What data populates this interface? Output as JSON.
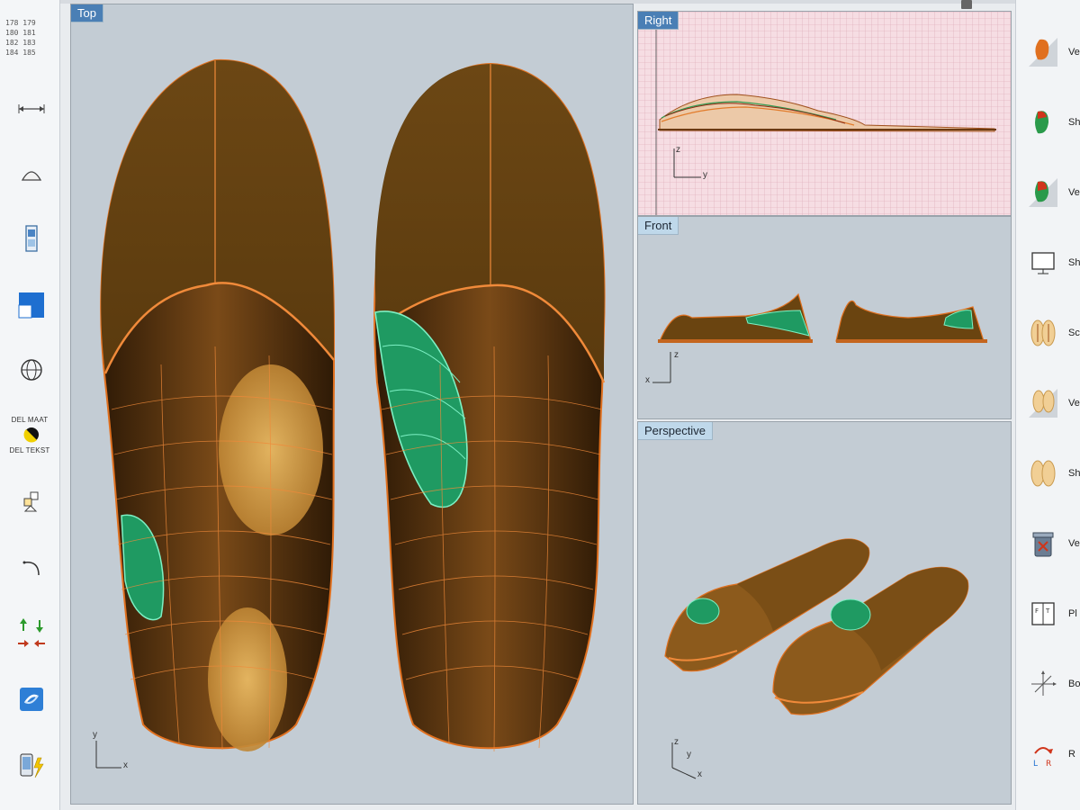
{
  "left_toolbar": {
    "numbers": [
      "178  179",
      "180  181",
      "182  183",
      "184  185"
    ],
    "del_maat": "DEL MAAT",
    "del_tekst": "DEL TEKST",
    "icons": [
      "dimension-icon",
      "arc-icon",
      "layers-icon",
      "window-icon",
      "globe-icon",
      "split-color-icon",
      "shapes-icon",
      "rotate-icon",
      "move-arrows-icon",
      "swap-icon",
      "phone-flash-icon"
    ]
  },
  "viewports": {
    "top": {
      "title": "Top",
      "axis_y": "y",
      "axis_x": "x"
    },
    "right": {
      "title": "Right",
      "axis_z": "z",
      "axis_y": "y"
    },
    "front": {
      "title": "Front",
      "axis_z": "z",
      "axis_x": "x"
    },
    "perspective": {
      "title": "Perspective",
      "axis_z": "z",
      "axis_y": "y",
      "axis_x": "x"
    }
  },
  "right_toolbar": {
    "items": [
      {
        "label": "Ve",
        "icon": "orange-foot-icon"
      },
      {
        "label": "Sh",
        "icon": "green-foot-icon"
      },
      {
        "label": "Ve",
        "icon": "red-green-foot-icon"
      },
      {
        "label": "Sh",
        "icon": "monitor-icon"
      },
      {
        "label": "Sc",
        "icon": "feet-scale-icon"
      },
      {
        "label": "Ve",
        "icon": "feet-view-icon"
      },
      {
        "label": "Sh",
        "icon": "feet-show-icon"
      },
      {
        "label": "Ve",
        "icon": "trash-icon"
      },
      {
        "label": "Pl",
        "icon": "plane-icon"
      },
      {
        "label": "Bo",
        "icon": "axes-icon"
      },
      {
        "label": "R",
        "icon": "lr-rotate-icon"
      }
    ]
  },
  "colors": {
    "viewport_bg": "#c3ccd4",
    "grid_pink": "#f6dde3",
    "insole_brown": "#6a4410",
    "wire_orange": "#f08a3a",
    "pad_green": "#1f9a62"
  }
}
